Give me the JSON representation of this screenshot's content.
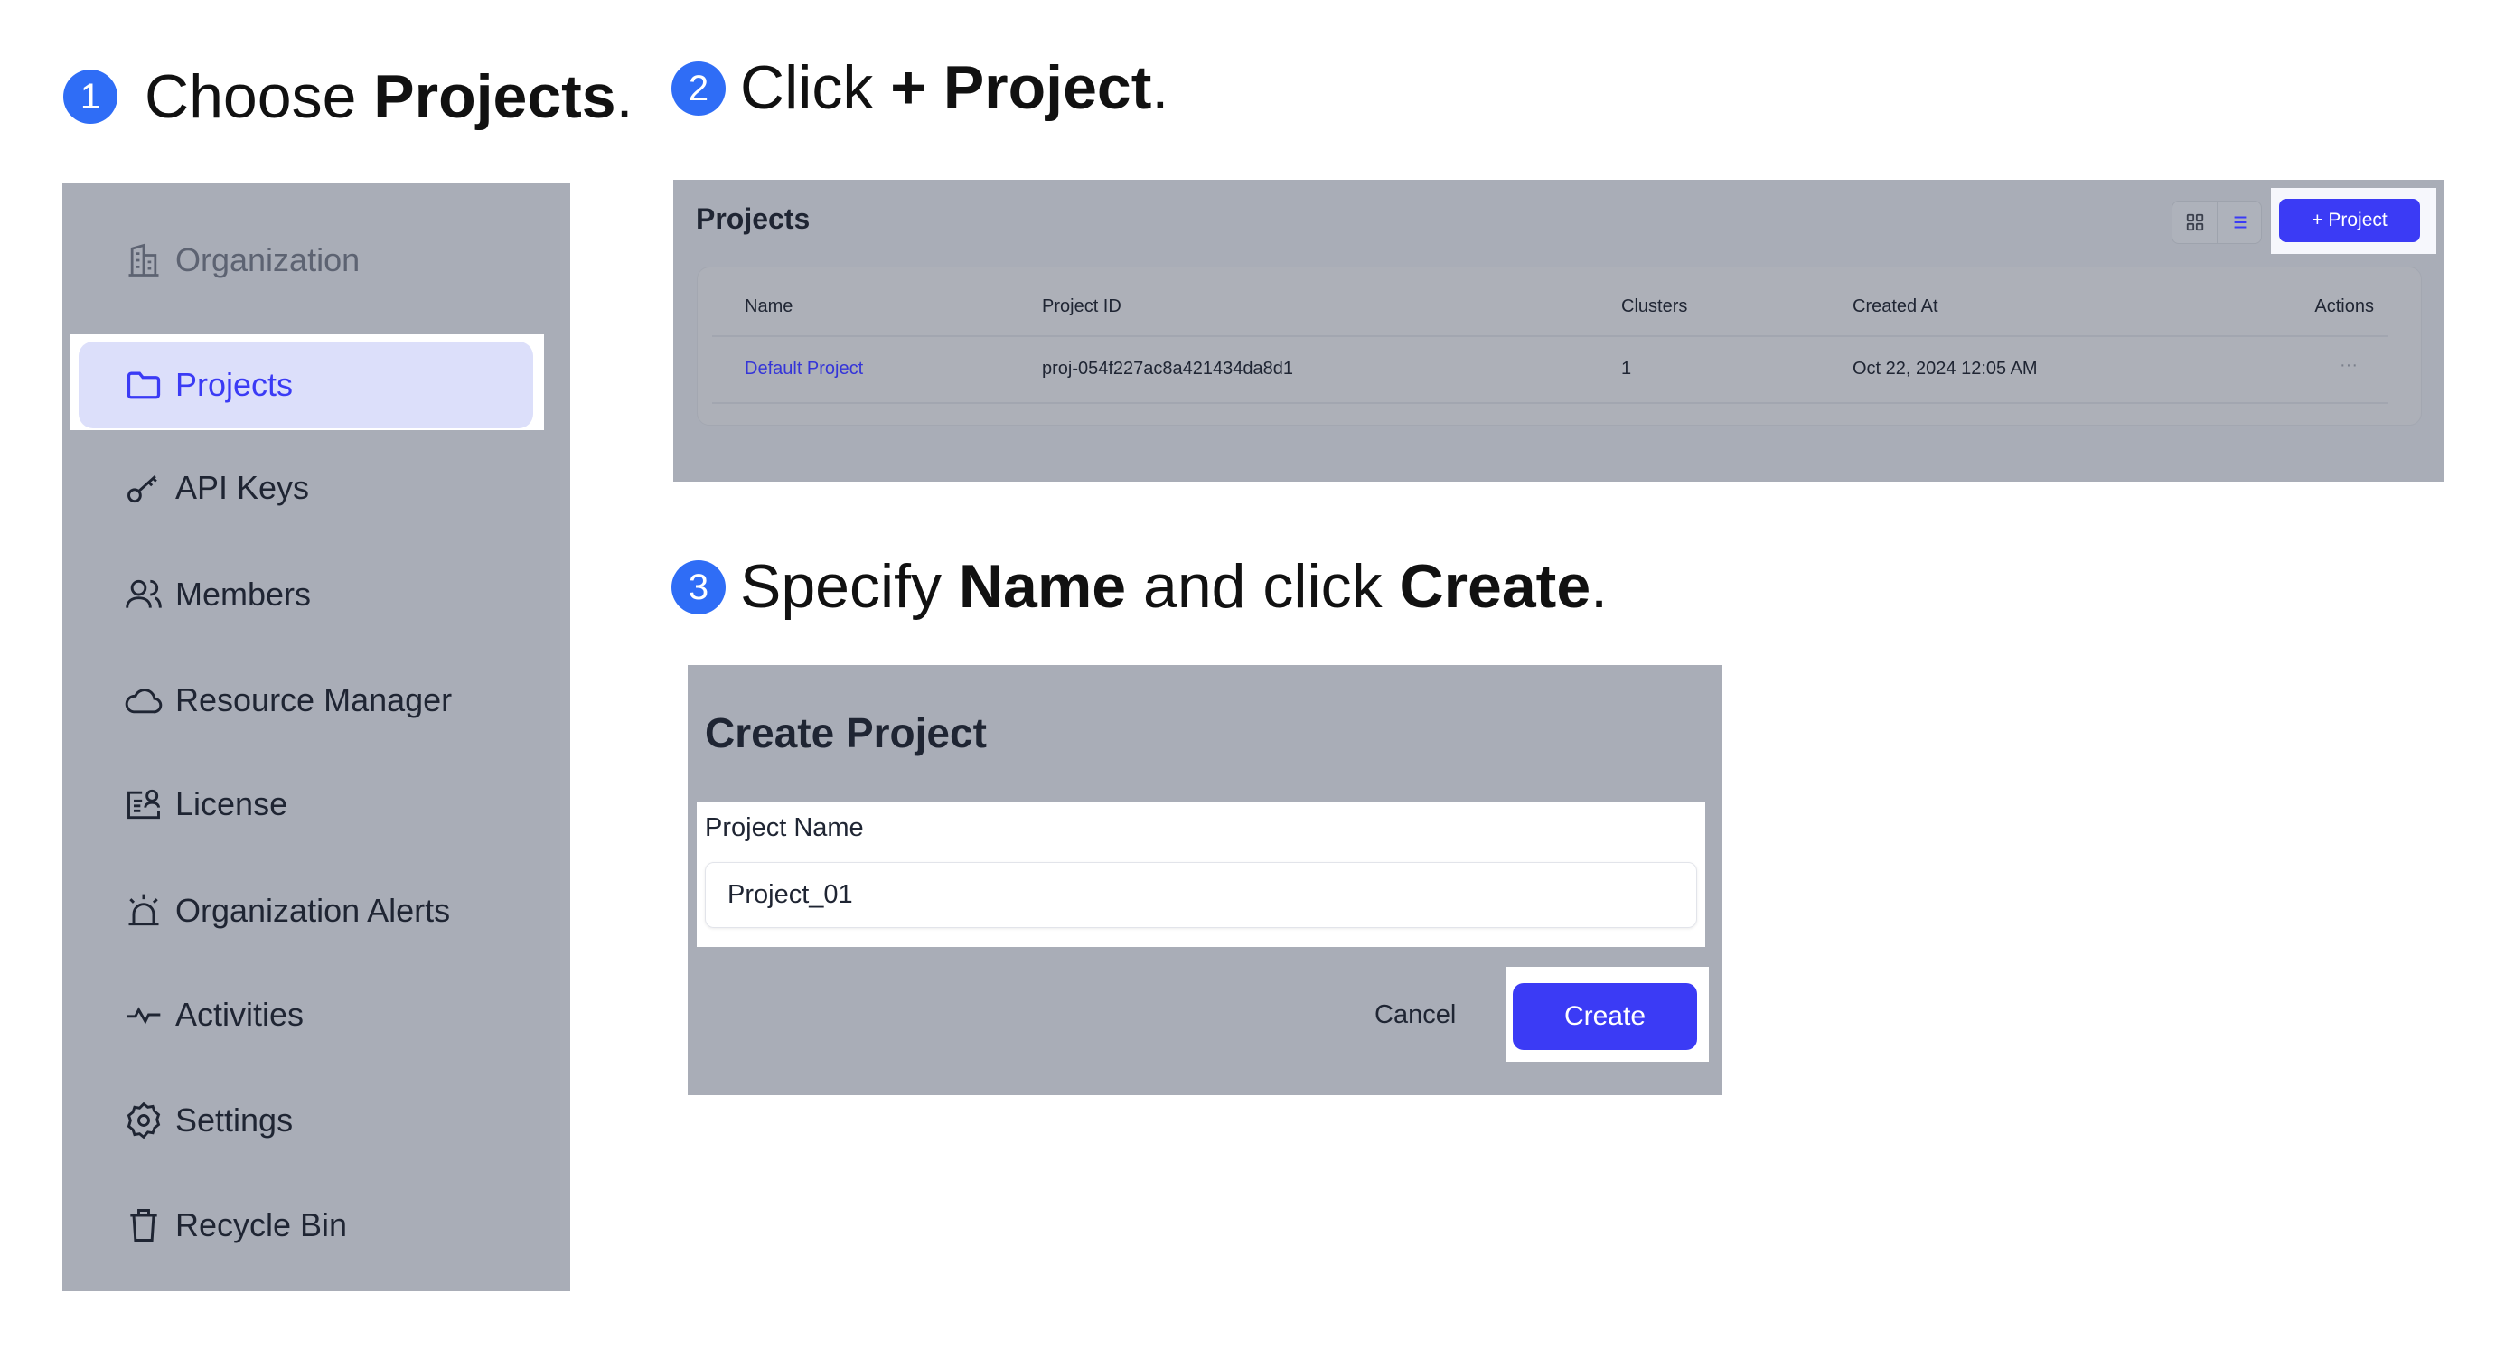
{
  "steps": [
    {
      "number": "1",
      "prefix": "Choose ",
      "bold": "Projects",
      "suffix": "."
    },
    {
      "number": "2",
      "prefix": "Click ",
      "bold": "+ Project",
      "suffix": "."
    },
    {
      "number": "3",
      "prefix": "Specify ",
      "bold": "Name",
      "middle": " and click ",
      "bold2": "Create",
      "suffix": "."
    }
  ],
  "sidebar": {
    "items": [
      {
        "label": "Organization",
        "icon": "building-icon"
      },
      {
        "label": "Projects",
        "icon": "folder-icon",
        "active": true
      },
      {
        "label": "API Keys",
        "icon": "key-icon"
      },
      {
        "label": "Members",
        "icon": "users-icon"
      },
      {
        "label": "Resource Manager",
        "icon": "cloud-icon"
      },
      {
        "label": "License",
        "icon": "license-icon"
      },
      {
        "label": "Organization Alerts",
        "icon": "alarm-icon"
      },
      {
        "label": "Activities",
        "icon": "activity-icon"
      },
      {
        "label": "Settings",
        "icon": "gear-icon"
      },
      {
        "label": "Recycle Bin",
        "icon": "trash-icon"
      }
    ]
  },
  "projects": {
    "title": "Projects",
    "add_button": "+ Project",
    "columns": [
      "Name",
      "Project ID",
      "Clusters",
      "Created At",
      "Actions"
    ],
    "rows": [
      {
        "name": "Default Project",
        "id": "proj-054f227ac8a421434da8d1",
        "clusters": "1",
        "created": "Oct 22, 2024 12:05 AM",
        "actions": "···"
      }
    ]
  },
  "create_dialog": {
    "title": "Create Project",
    "field_label": "Project Name",
    "field_value": "Project_01",
    "cancel": "Cancel",
    "create": "Create"
  },
  "colors": {
    "accent": "#3b3bf5",
    "step_badge": "#2f6df6",
    "overlay": "#a9adb7",
    "active_bg": "#dcdffa"
  }
}
